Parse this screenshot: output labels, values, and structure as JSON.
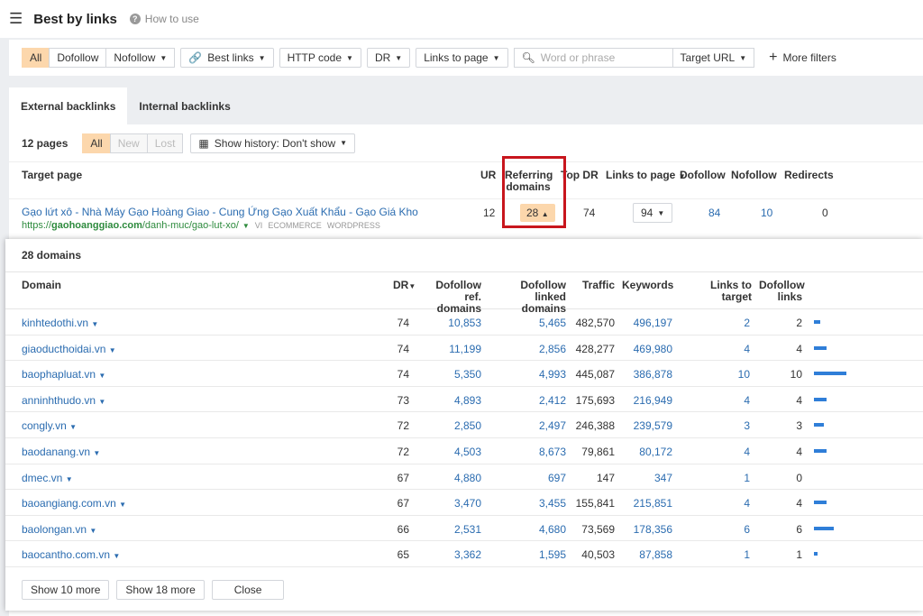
{
  "header": {
    "title": "Best by links",
    "how_to_use": "How to use"
  },
  "filters": {
    "type_options": [
      "All",
      "Dofollow"
    ],
    "nofollow": "Nofollow",
    "best_links": "Best links",
    "http_code": "HTTP code",
    "dr": "DR",
    "links_to_page": "Links to page",
    "search_placeholder": "Word or phrase",
    "target_url": "Target URL",
    "more_filters": "More filters"
  },
  "tabs": [
    {
      "label": "External backlinks",
      "active": true
    },
    {
      "label": "Internal backlinks",
      "active": false
    }
  ],
  "subbar": {
    "count": "12 pages",
    "segments": [
      "All",
      "New",
      "Lost"
    ],
    "history": "Show history: Don't show"
  },
  "table": {
    "headers": {
      "target": "Target page",
      "ur": "UR",
      "ref": "Referring domains",
      "topdr": "Top DR",
      "links": "Links to page",
      "dofollow": "Dofollow",
      "nofollow": "Nofollow",
      "redirects": "Redirects"
    },
    "row": {
      "title": "Gạo lứt xô - Nhà Máy Gạo Hoàng Giao - Cung Ứng Gạo Xuất Khẩu - Gạo Giá Kho",
      "url_prefix": "https://",
      "url_domain": "gaohoanggiao.com",
      "url_path": "/danh-muc/gao-lut-xo/",
      "lang": "VI",
      "tag1": "ECOMMERCE",
      "tag2": "WORDPRESS",
      "ur": "12",
      "ref": "28",
      "topdr": "74",
      "links": "94",
      "dofollow": "84",
      "nofollow": "10",
      "redirects": "0"
    }
  },
  "popup": {
    "title": "28 domains",
    "headers": {
      "domain": "Domain",
      "dr": "DR",
      "dref": "Dofollow ref. domains",
      "dlinked": "Dofollow linked domains",
      "traffic": "Traffic",
      "keywords": "Keywords",
      "ltt": "Links to target",
      "dlinks": "Dofollow links"
    },
    "rows": [
      {
        "domain": "kinhtedothi.vn",
        "dr": "74",
        "dref": "10,853",
        "dlinked": "5,465",
        "traffic": "482,570",
        "keywords": "496,197",
        "ltt": "2",
        "dlinks": "2",
        "bar": 2
      },
      {
        "domain": "giaoducthoidai.vn",
        "dr": "74",
        "dref": "11,199",
        "dlinked": "2,856",
        "traffic": "428,277",
        "keywords": "469,980",
        "ltt": "4",
        "dlinks": "4",
        "bar": 4
      },
      {
        "domain": "baophapluat.vn",
        "dr": "74",
        "dref": "5,350",
        "dlinked": "4,993",
        "traffic": "445,087",
        "keywords": "386,878",
        "ltt": "10",
        "dlinks": "10",
        "bar": 10
      },
      {
        "domain": "anninhthudo.vn",
        "dr": "73",
        "dref": "4,893",
        "dlinked": "2,412",
        "traffic": "175,693",
        "keywords": "216,949",
        "ltt": "4",
        "dlinks": "4",
        "bar": 4
      },
      {
        "domain": "congly.vn",
        "dr": "72",
        "dref": "2,850",
        "dlinked": "2,497",
        "traffic": "246,388",
        "keywords": "239,579",
        "ltt": "3",
        "dlinks": "3",
        "bar": 3
      },
      {
        "domain": "baodanang.vn",
        "dr": "72",
        "dref": "4,503",
        "dlinked": "8,673",
        "traffic": "79,861",
        "keywords": "80,172",
        "ltt": "4",
        "dlinks": "4",
        "bar": 4
      },
      {
        "domain": "dmec.vn",
        "dr": "67",
        "dref": "4,880",
        "dlinked": "697",
        "traffic": "147",
        "keywords": "347",
        "ltt": "1",
        "dlinks": "0",
        "bar": 0
      },
      {
        "domain": "baoangiang.com.vn",
        "dr": "67",
        "dref": "3,470",
        "dlinked": "3,455",
        "traffic": "155,841",
        "keywords": "215,851",
        "ltt": "4",
        "dlinks": "4",
        "bar": 4
      },
      {
        "domain": "baolongan.vn",
        "dr": "66",
        "dref": "2,531",
        "dlinked": "4,680",
        "traffic": "73,569",
        "keywords": "178,356",
        "ltt": "6",
        "dlinks": "6",
        "bar": 6
      },
      {
        "domain": "baocantho.com.vn",
        "dr": "65",
        "dref": "3,362",
        "dlinked": "1,595",
        "traffic": "40,503",
        "keywords": "87,858",
        "ltt": "1",
        "dlinks": "1",
        "bar": 1
      }
    ],
    "buttons": {
      "show10": "Show 10 more",
      "show18": "Show 18 more",
      "close": "Close"
    }
  },
  "colors": {
    "accent": "#fcd7ac",
    "link": "#2b6cb0",
    "bar": "#2f7ed8",
    "highlight": "#c8161d"
  }
}
